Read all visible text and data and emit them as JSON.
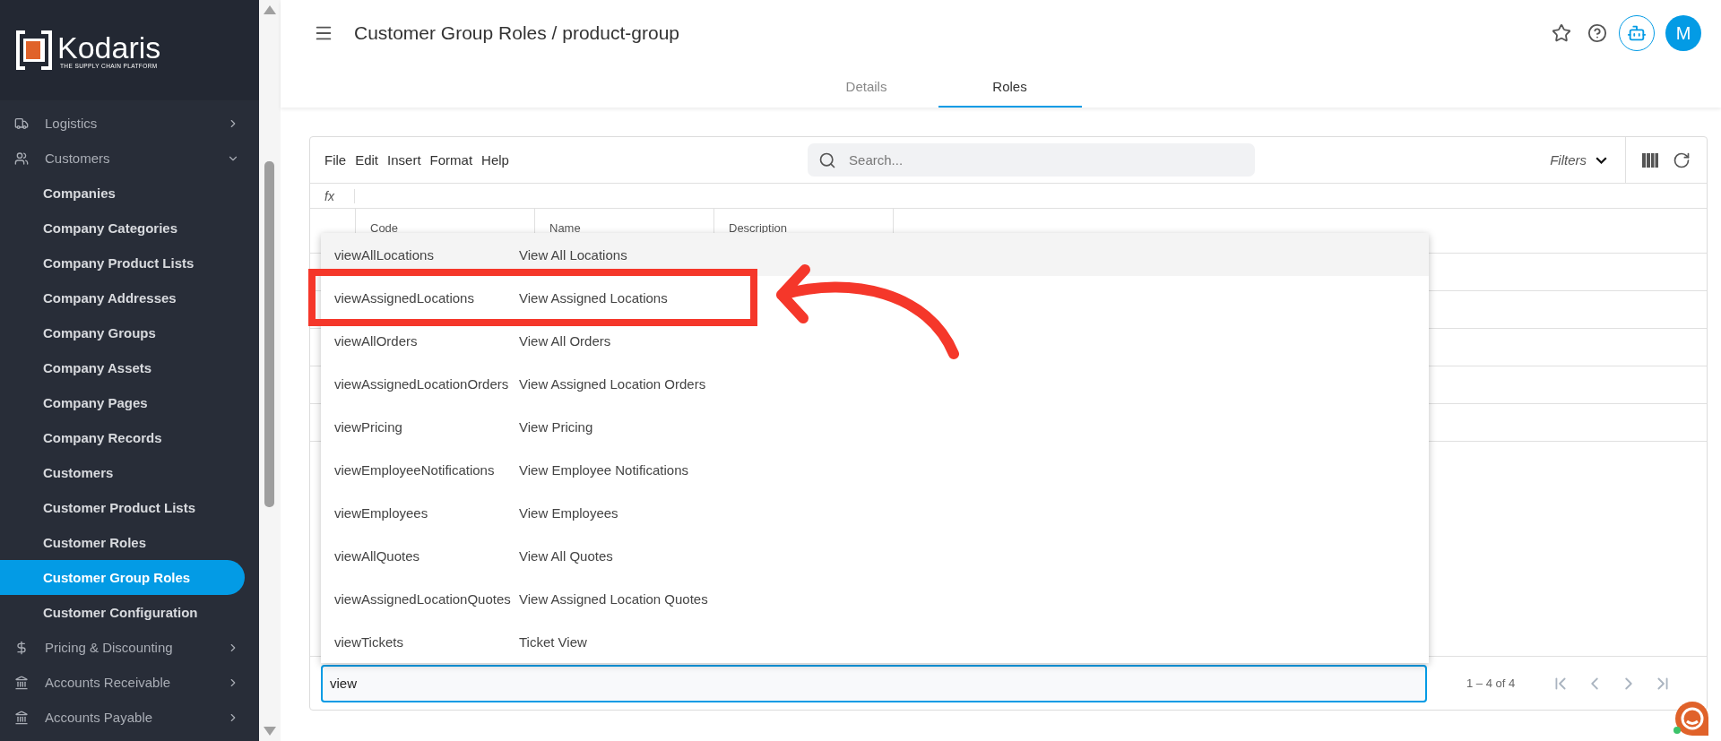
{
  "sidebar": {
    "logo": {
      "name": "Kodaris",
      "tagline": "THE SUPPLY CHAIN PLATFORM"
    },
    "items": [
      {
        "label": "Logistics",
        "expanded": false
      },
      {
        "label": "Customers",
        "expanded": true,
        "children": [
          {
            "label": "Companies",
            "selected": false
          },
          {
            "label": "Company Categories",
            "selected": false
          },
          {
            "label": "Company Product Lists",
            "selected": false
          },
          {
            "label": "Company Addresses",
            "selected": false
          },
          {
            "label": "Company Groups",
            "selected": false
          },
          {
            "label": "Company Assets",
            "selected": false
          },
          {
            "label": "Company Pages",
            "selected": false
          },
          {
            "label": "Company Records",
            "selected": false
          },
          {
            "label": "Customers",
            "selected": false
          },
          {
            "label": "Customer Product Lists",
            "selected": false
          },
          {
            "label": "Customer Roles",
            "selected": false
          },
          {
            "label": "Customer Group Roles",
            "selected": true
          },
          {
            "label": "Customer Configuration",
            "selected": false
          }
        ]
      },
      {
        "label": "Pricing & Discounting",
        "expanded": false
      },
      {
        "label": "Accounts Receivable",
        "expanded": false
      },
      {
        "label": "Accounts Payable",
        "expanded": false
      }
    ]
  },
  "header": {
    "title": "Customer Group Roles / product-group",
    "avatar": "M",
    "tabs": [
      {
        "label": "Details",
        "selected": false
      },
      {
        "label": "Roles",
        "selected": true
      }
    ]
  },
  "grid": {
    "menu": [
      "File",
      "Edit",
      "Insert",
      "Format",
      "Help"
    ],
    "search": {
      "placeholder": "Search..."
    },
    "filters": "Filters",
    "formula_label": "fx",
    "columns": [
      "Code",
      "Name",
      "Description"
    ],
    "suggestions": [
      {
        "code": "viewAllLocations",
        "name": "View All Locations",
        "selected": true,
        "annotated": false
      },
      {
        "code": "viewAssignedLocations",
        "name": "View Assigned Locations",
        "selected": false,
        "annotated": true
      },
      {
        "code": "viewAllOrders",
        "name": "View All Orders",
        "selected": false,
        "annotated": false
      },
      {
        "code": "viewAssignedLocationOrders",
        "name": "View Assigned Location Orders",
        "selected": false,
        "annotated": false
      },
      {
        "code": "viewPricing",
        "name": "View Pricing",
        "selected": false,
        "annotated": false
      },
      {
        "code": "viewEmployeeNotifications",
        "name": "View Employee Notifications",
        "selected": false,
        "annotated": false
      },
      {
        "code": "viewEmployees",
        "name": "View Employees",
        "selected": false,
        "annotated": false
      },
      {
        "code": "viewAllQuotes",
        "name": "View All Quotes",
        "selected": false,
        "annotated": false
      },
      {
        "code": "viewAssignedLocationQuotes",
        "name": "View Assigned Location Quotes",
        "selected": false,
        "annotated": false
      },
      {
        "code": "viewTickets",
        "name": "Ticket View",
        "selected": false,
        "annotated": false
      }
    ],
    "editor": {
      "value": "view"
    },
    "pagination": "1 – 4 of 4"
  }
}
